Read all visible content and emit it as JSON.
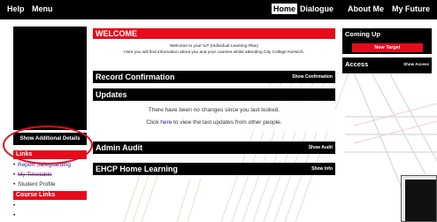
{
  "topbar": {
    "help": "Help",
    "menu": "Menu",
    "nav": [
      "Home",
      "Dialogue",
      "About Me",
      "My Future"
    ]
  },
  "sidebar": {
    "show_details": "Show Additional Details",
    "links_heading": "Links",
    "links": [
      "Report Safeguarding",
      "My Timetable",
      "Student Profile"
    ],
    "course_links_heading": "Course Links",
    "course_links": [
      "",
      ""
    ]
  },
  "welcome": {
    "title": "WELCOME",
    "line1": "Welcome to your ILP (Individual Learning Plan)",
    "line2": "Here you will find information about you and your courses whilst attending City College Norwich."
  },
  "record": {
    "title": "Record Confirmation",
    "action": "Show Confirmation"
  },
  "updates": {
    "title": "Updates",
    "line1": "There have been no changes since you last looked.",
    "click": "Click",
    "here": "here",
    "line2_rest": "to view the last updates from other people."
  },
  "admin": {
    "title": "Admin Audit",
    "action": "Show Audit"
  },
  "ehcp": {
    "title": "EHCP Home Learning",
    "action": "Show Info"
  },
  "right": {
    "coming_up": "Coming Up",
    "new_target": "New Target",
    "access": "Access",
    "show_access": "Show Access"
  },
  "colors": {
    "accent": "#e50b1c",
    "dark": "#000000",
    "link": "#1a1aa6"
  }
}
